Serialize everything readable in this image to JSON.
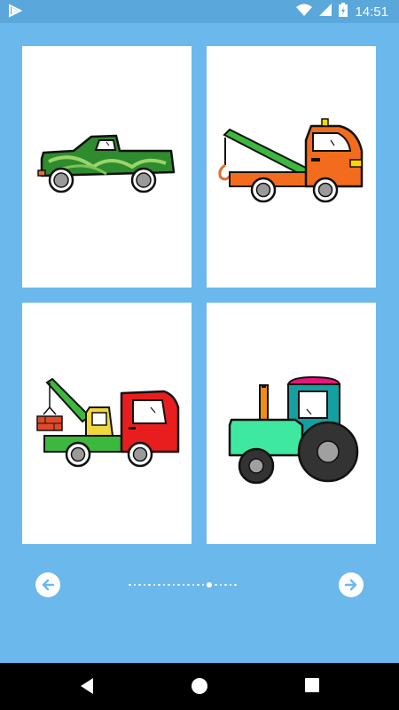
{
  "status_bar": {
    "time": "14:51",
    "icons": [
      "notification-icon",
      "wifi-icon",
      "cell-signal-icon",
      "battery-charging-icon"
    ]
  },
  "gallery": {
    "cards": [
      {
        "name": "pickup-truck",
        "colors": {
          "body": "#2e8b2e",
          "stripe": "#9ad46a"
        }
      },
      {
        "name": "tow-truck",
        "colors": {
          "cab": "#f36c1e",
          "boom": "#3cb83c",
          "light": "#ffd700"
        }
      },
      {
        "name": "crane-truck",
        "colors": {
          "cab": "#e81e1e",
          "hook_cab": "#f0d83c",
          "boom": "#3cb83c",
          "bed": "#3cb83c"
        }
      },
      {
        "name": "tractor",
        "colors": {
          "body": "#3fe8a0",
          "cab": "#14a0a0",
          "roof": "#e8157a",
          "exhaust": "#f08c14"
        }
      }
    ]
  },
  "pager": {
    "total": 22,
    "active_index": 16
  },
  "navigation": {
    "prev_icon": "arrow-left-icon",
    "next_icon": "arrow-right-icon"
  },
  "system_nav": {
    "icons": [
      "back-icon",
      "home-icon",
      "recents-icon"
    ]
  },
  "theme": {
    "background": "#6bb8ec",
    "status_bar": "#5aa7db",
    "accent_arrow": "#6bb8ec"
  }
}
